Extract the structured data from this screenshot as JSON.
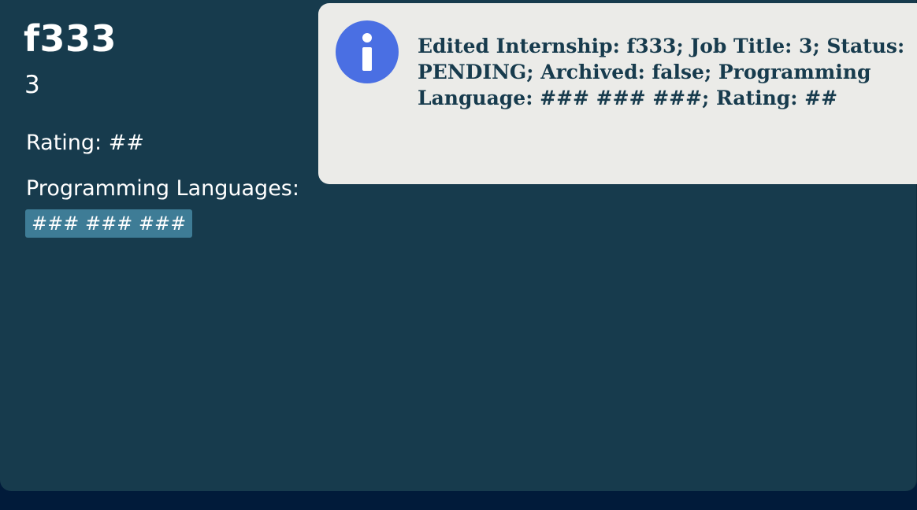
{
  "card": {
    "company": "f333",
    "job_title": "3",
    "rating_text": "Rating: ##",
    "languages_label": "Programming Languages:",
    "languages": [
      "### ### ###"
    ]
  },
  "toast": {
    "icon": "info-icon",
    "message": "Edited Internship: f333; Job Title: 3; Status: PENDING; Archived: false; Programming Language: ### ### ###; Rating: ##"
  },
  "colors": {
    "background": "#011b3a",
    "card": "#173b4d",
    "tag": "#3e7c96",
    "toast": "#ebebe8",
    "info_icon": "#4a6fe3"
  }
}
